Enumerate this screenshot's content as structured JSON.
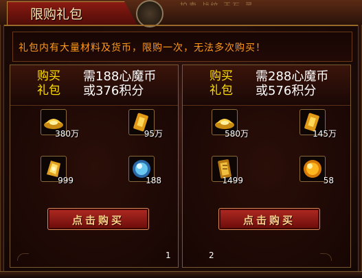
{
  "window": {
    "title": "限购礼包",
    "notice": "礼包内有大量材料及货币，限购一次，无法多次购买！",
    "top_ghost_text": "拍卖 战纹 玉石 灵..."
  },
  "packs": [
    {
      "buy_label_line1": "购买",
      "buy_label_line2": "礼包",
      "price_line1": "需188心魔币",
      "price_line2": "或376积分",
      "items": [
        {
          "icon": "gold-ingot-icon",
          "qty": "380万"
        },
        {
          "icon": "gold-ticket-icon",
          "qty": "95万"
        },
        {
          "icon": "gold-fragment-icon",
          "qty": "999"
        },
        {
          "icon": "blue-crystal-icon",
          "qty": "188"
        }
      ],
      "button_label": "点击购买",
      "page_number": "1"
    },
    {
      "buy_label_line1": "购买",
      "buy_label_line2": "礼包",
      "price_line1": "需288心魔币",
      "price_line2": "或576积分",
      "items": [
        {
          "icon": "gold-ingot-icon",
          "qty": "580万"
        },
        {
          "icon": "gold-ticket-icon",
          "qty": "145万"
        },
        {
          "icon": "gold-scroll-icon",
          "qty": "1499"
        },
        {
          "icon": "gold-orb-icon",
          "qty": "58"
        }
      ],
      "button_label": "点击购买",
      "page_number": "2"
    }
  ],
  "colors": {
    "notice_text": "#ff9a1a",
    "buy_label": "#ffe000",
    "button": "#b02a22",
    "border": "#7a5a30"
  }
}
